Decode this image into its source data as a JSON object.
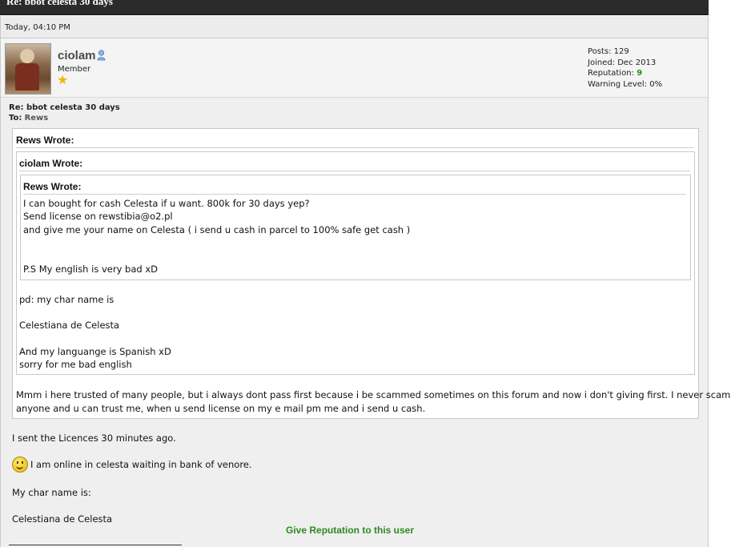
{
  "post": {
    "header_title": "Re: bbot celesta 30 days",
    "date": "Today, 04:10 PM",
    "title": "Re: bbot celesta 30 days",
    "to_label": "To:",
    "recipient": "Rews"
  },
  "user": {
    "name": "ciolam",
    "rank": "Member",
    "stats": {
      "posts": "Posts: 129",
      "joined": "Joined: Dec 2013",
      "reputation_label": "Reputation:",
      "reputation_value": "9",
      "warning": "Warning Level: 0%"
    }
  },
  "quotes": {
    "outer": {
      "header": "Rews Wrote:",
      "reply": [
        "Mmm i here trusted of many people, but i always dont pass first because i be scammed sometimes on this forum and now i don't giving first. I never scam",
        "anyone and u can trust me, when u send license on my e mail pm me and i send u cash."
      ]
    },
    "middle": {
      "header": "ciolam Wrote:",
      "lines": [
        "pd: my char name is",
        "Celestiana de Celesta",
        "And my languange is Spanish xD",
        "sorry for me bad english"
      ]
    },
    "inner": {
      "header": "Rews Wrote:",
      "lines": [
        "I can bought for cash Celesta if u want. 800k for 30 days yep?",
        "Send license on rewstibia@o2.pl",
        "and give me your name on Celesta ( i send u cash in parcel to 100% safe get cash )",
        "P.S My english is very bad xD"
      ]
    }
  },
  "body": {
    "line1": "I sent the Licences 30 minutes ago.",
    "line2": "I am online in celesta waiting in bank of venore.",
    "line3": "My char name is:",
    "line4": "Celestiana de Celesta"
  },
  "actions": {
    "give_reputation": "Give Reputation to this user"
  },
  "colors": {
    "reputation_green": "#2c8a1e",
    "title_bar": "#2b2b2b"
  }
}
